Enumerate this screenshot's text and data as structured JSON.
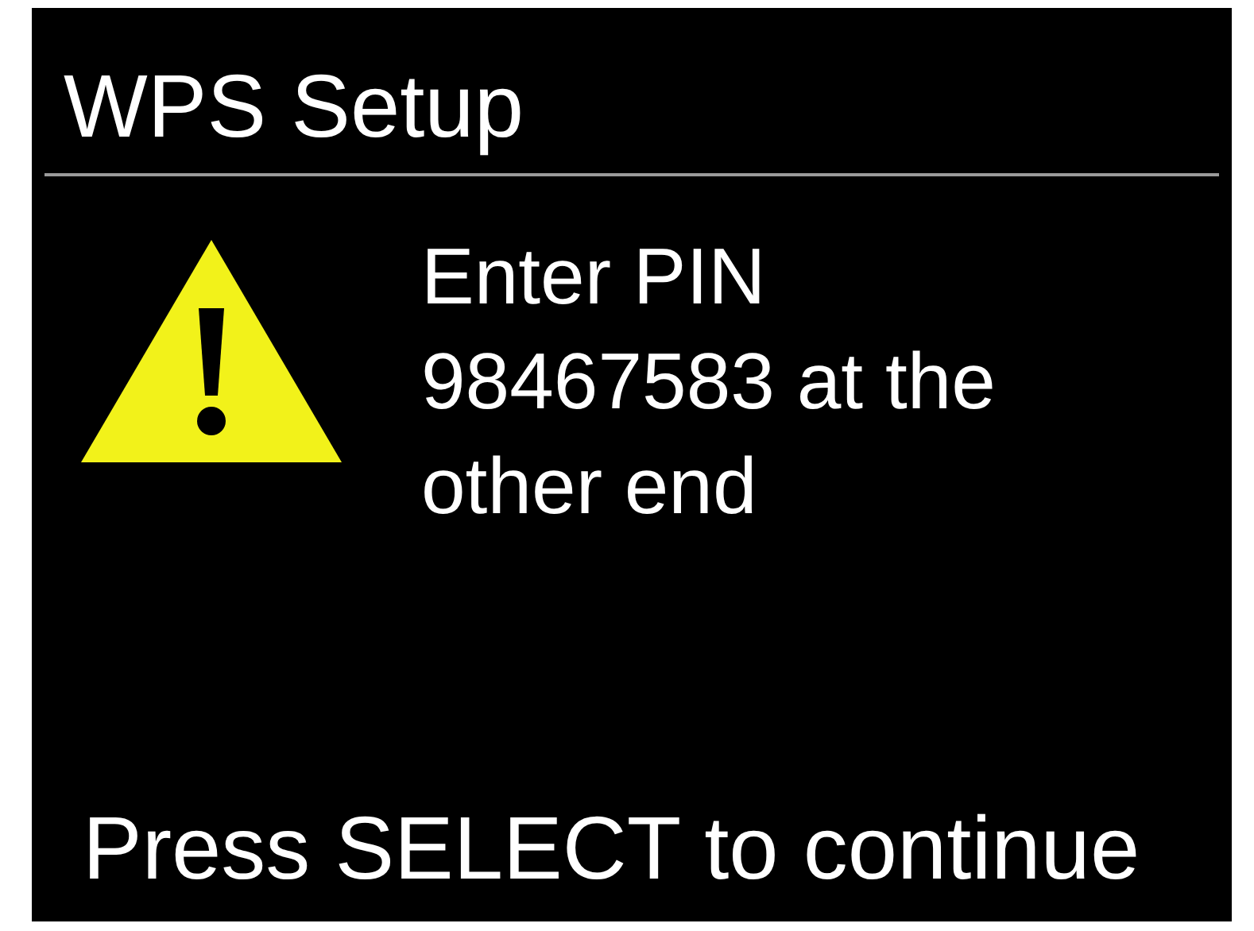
{
  "title": "WPS Setup",
  "message": "Enter PIN 98467583 at the other end",
  "footer": "Press SELECT to continue"
}
